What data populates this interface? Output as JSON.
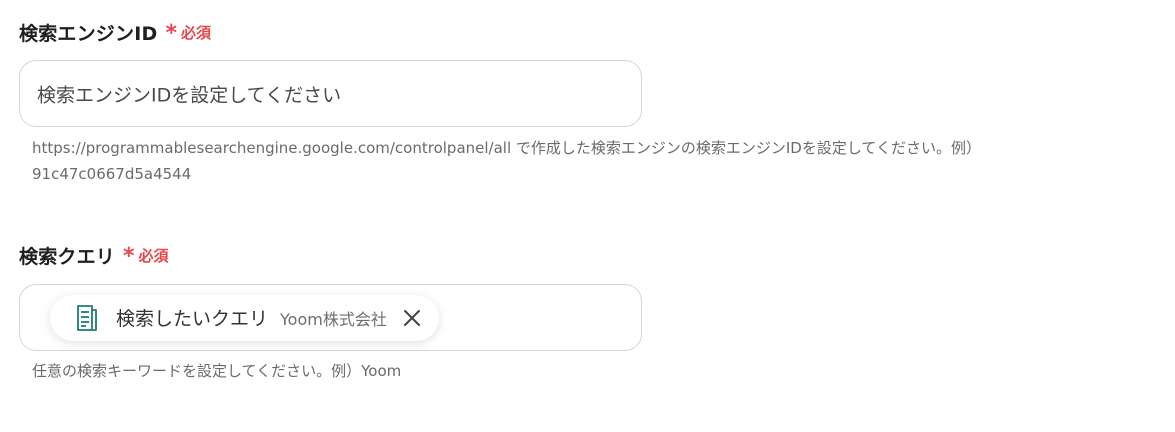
{
  "engine_id_field": {
    "label": "検索エンジンID",
    "required_mark": "*",
    "required_text": "必須",
    "placeholder": "検索エンジンIDを設定してください",
    "help_line1": "https://programmablesearchengine.google.com/controlpanel/all で作成した検索エンジンの検索エンジンIDを設定してください。例）",
    "help_line2": "91c47c0667d5a4544"
  },
  "query_field": {
    "label": "検索クエリ",
    "required_mark": "*",
    "required_text": "必須",
    "chip": {
      "icon": "document-list-icon",
      "label": "検索したいクエリ",
      "source": "Yoom株式会社",
      "close_icon": "close-icon"
    },
    "help": "任意の検索キーワードを設定してください。例）Yoom"
  },
  "colors": {
    "required": "#e5484d",
    "chip_icon": "#1f7a75",
    "border": "#d6d6d6",
    "help_text": "#6b6b6b"
  }
}
